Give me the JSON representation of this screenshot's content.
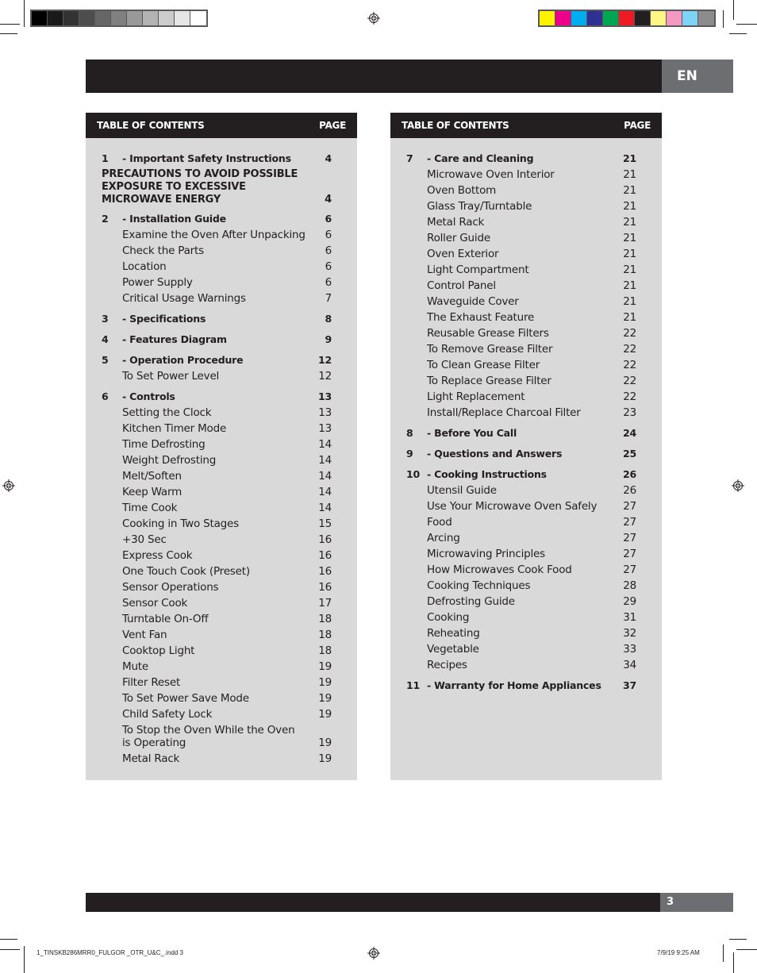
{
  "print_marks": {
    "gray_swatches": [
      "#000000",
      "#1a1a1a",
      "#333333",
      "#4d4d4d",
      "#666666",
      "#808080",
      "#999999",
      "#b3b3b3",
      "#cccccc",
      "#e6e6e6",
      "#ffffff"
    ],
    "color_swatches": [
      "#fff200",
      "#ec008c",
      "#00aeef",
      "#2e3192",
      "#00a651",
      "#ed1c24",
      "#231f20",
      "#fff685",
      "#f49ac2",
      "#7fd3f7",
      "#8c8c8c"
    ],
    "slug_file": "1_TINSKB286MRR0_FULGOR _OTR_U&C_.indd   3",
    "slug_date": "7/9/19   9:25 AM"
  },
  "header": {
    "language": "EN"
  },
  "footer": {
    "page_number": "3"
  },
  "toc_left": {
    "title": "TABLE OF CONTENTS",
    "page_label": "PAGE",
    "entries": [
      {
        "type": "sec",
        "num": "1",
        "label": "- Important Safety Instructions",
        "page": "4"
      },
      {
        "type": "caps",
        "label": "PRECAUTIONS TO AVOID POSSIBLE\nEXPOSURE TO EXCESSIVE\nMICROWAVE ENERGY",
        "page": "4"
      },
      {
        "type": "sec",
        "num": "2",
        "label": "- Installation Guide",
        "page": "6"
      },
      {
        "type": "sub",
        "label": "Examine the Oven After Unpacking",
        "page": "6"
      },
      {
        "type": "sub",
        "label": "Check the Parts",
        "page": "6"
      },
      {
        "type": "sub",
        "label": "Location",
        "page": "6"
      },
      {
        "type": "sub",
        "label": "Power Supply",
        "page": "6"
      },
      {
        "type": "sub",
        "label": "Critical Usage Warnings",
        "page": "7"
      },
      {
        "type": "sec",
        "num": "3",
        "label": "- Specifications",
        "page": "8"
      },
      {
        "type": "sec",
        "num": "4",
        "label": "- Features Diagram",
        "page": "9"
      },
      {
        "type": "sec",
        "num": "5",
        "label": "- Operation Procedure",
        "page": "12"
      },
      {
        "type": "sub",
        "label": "To Set Power Level",
        "page": "12"
      },
      {
        "type": "sec",
        "num": "6",
        "label": "- Controls",
        "page": "13"
      },
      {
        "type": "sub",
        "label": "Setting the Clock",
        "page": "13"
      },
      {
        "type": "sub",
        "label": "Kitchen Timer Mode",
        "page": "13"
      },
      {
        "type": "sub",
        "label": "Time Defrosting",
        "page": "14"
      },
      {
        "type": "sub",
        "label": "Weight Defrosting",
        "page": "14"
      },
      {
        "type": "sub",
        "label": "Melt/Soften",
        "page": "14"
      },
      {
        "type": "sub",
        "label": "Keep Warm",
        "page": "14"
      },
      {
        "type": "sub",
        "label": "Time Cook",
        "page": "14"
      },
      {
        "type": "sub",
        "label": "Cooking in Two Stages",
        "page": "15"
      },
      {
        "type": "sub",
        "label": "+30 Sec",
        "page": "16"
      },
      {
        "type": "sub",
        "label": "Express Cook",
        "page": "16"
      },
      {
        "type": "sub",
        "label": "One Touch Cook (Preset)",
        "page": "16"
      },
      {
        "type": "sub",
        "label": "Sensor Operations",
        "page": "16"
      },
      {
        "type": "sub",
        "label": "Sensor Cook",
        "page": "17"
      },
      {
        "type": "sub",
        "label": "Turntable On-Off",
        "page": "18"
      },
      {
        "type": "sub",
        "label": "Vent Fan",
        "page": "18"
      },
      {
        "type": "sub",
        "label": "Cooktop Light",
        "page": "18"
      },
      {
        "type": "sub",
        "label": "Mute",
        "page": "19"
      },
      {
        "type": "sub",
        "label": "Filter Reset",
        "page": "19"
      },
      {
        "type": "sub",
        "label": "To Set Power Save Mode",
        "page": "19"
      },
      {
        "type": "sub",
        "label": "Child Safety Lock",
        "page": "19"
      },
      {
        "type": "subwrap",
        "label": "To Stop the Oven While the Oven\nis Operating",
        "page": "19"
      },
      {
        "type": "sub",
        "label": "Metal Rack",
        "page": "19"
      }
    ]
  },
  "toc_right": {
    "title": "TABLE OF CONTENTS",
    "page_label": "PAGE",
    "entries": [
      {
        "type": "sec",
        "num": "7",
        "label": "- Care and Cleaning",
        "page": "21"
      },
      {
        "type": "sub",
        "label": "Microwave Oven Interior",
        "page": "21"
      },
      {
        "type": "sub",
        "label": "Oven Bottom",
        "page": "21"
      },
      {
        "type": "sub",
        "label": "Glass Tray/Turntable",
        "page": "21"
      },
      {
        "type": "sub",
        "label": "Metal Rack",
        "page": "21"
      },
      {
        "type": "sub",
        "label": "Roller Guide",
        "page": "21"
      },
      {
        "type": "sub",
        "label": "Oven Exterior",
        "page": "21"
      },
      {
        "type": "sub",
        "label": "Light Compartment",
        "page": "21"
      },
      {
        "type": "sub",
        "label": "Control Panel",
        "page": "21"
      },
      {
        "type": "sub",
        "label": "Waveguide Cover",
        "page": "21"
      },
      {
        "type": "sub",
        "label": "The Exhaust Feature",
        "page": "21"
      },
      {
        "type": "sub",
        "label": "Reusable Grease Filters",
        "page": "22"
      },
      {
        "type": "sub",
        "label": "To Remove Grease Filter",
        "page": "22"
      },
      {
        "type": "sub",
        "label": "To Clean Grease Filter",
        "page": "22"
      },
      {
        "type": "sub",
        "label": "To Replace Grease Filter",
        "page": "22"
      },
      {
        "type": "sub",
        "label": "Light Replacement",
        "page": "22"
      },
      {
        "type": "sub",
        "label": "Install/Replace Charcoal Filter",
        "page": "23"
      },
      {
        "type": "sec",
        "num": "8",
        "label": "- Before You Call",
        "page": "24"
      },
      {
        "type": "sec",
        "num": "9",
        "label": "- Questions and Answers",
        "page": "25"
      },
      {
        "type": "sec",
        "num": "10",
        "label": "- Cooking Instructions",
        "page": "26"
      },
      {
        "type": "sub",
        "label": "Utensil Guide",
        "page": "26"
      },
      {
        "type": "sub",
        "label": "Use Your Microwave Oven Safely",
        "page": "27"
      },
      {
        "type": "sub",
        "label": "Food",
        "page": "27"
      },
      {
        "type": "sub",
        "label": "Arcing",
        "page": "27"
      },
      {
        "type": "sub",
        "label": "Microwaving Principles",
        "page": "27"
      },
      {
        "type": "sub",
        "label": "How Microwaves Cook Food",
        "page": "27"
      },
      {
        "type": "sub",
        "label": "Cooking Techniques",
        "page": "28"
      },
      {
        "type": "sub",
        "label": "Defrosting Guide",
        "page": "29"
      },
      {
        "type": "sub",
        "label": "Cooking",
        "page": "31"
      },
      {
        "type": "sub",
        "label": "Reheating",
        "page": "32"
      },
      {
        "type": "sub",
        "label": "Vegetable",
        "page": "33"
      },
      {
        "type": "sub",
        "label": "Recipes",
        "page": "34"
      },
      {
        "type": "sec",
        "num": "11",
        "label": "- Warranty for Home Appliances",
        "page": "37"
      }
    ]
  }
}
